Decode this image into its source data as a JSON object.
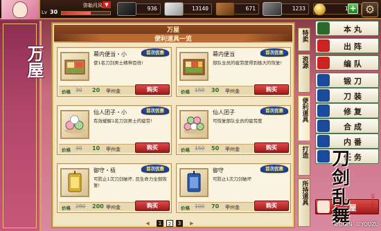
{
  "topbar": {
    "username": "弥勒月风",
    "flag": "▼",
    "lv_label": "Lv",
    "lv_value": "30",
    "lv_progress": 0.6,
    "resources": [
      {
        "name": "charcoal",
        "value": "936"
      },
      {
        "name": "steel",
        "value": "13140"
      },
      {
        "name": "coolant",
        "value": "671"
      },
      {
        "name": "whetstone",
        "value": "1233"
      }
    ],
    "coin_value": "1690",
    "plus_label": "+",
    "gear_label": "⚙"
  },
  "left_banner": {
    "title": "万屋"
  },
  "panel": {
    "title": "万屋",
    "subtitle": "便利道具一览",
    "price_label": "价格",
    "currency": "甲州金",
    "buy_label": "购买",
    "badge_label": "首次优惠",
    "items": [
      {
        "name": "幕内便当・小",
        "desc": "使1名刀剑男士精神百倍!",
        "old_price": "30",
        "new_price": "20"
      },
      {
        "name": "幕内便当",
        "desc": "部队全员的疲劳度得到极大的恢复!",
        "old_price": "150",
        "new_price": "30"
      },
      {
        "name": "仙人团子・小",
        "desc": "有效缓解1名刀剑男士的疲劳!",
        "old_price": "30",
        "new_price": "10"
      },
      {
        "name": "仙人团子",
        "desc": "可恢复部队全员的疲劳度",
        "old_price": "150",
        "new_price": "50"
      },
      {
        "name": "御守・极",
        "desc": "可防止1次刀剑破坏, 且生命力全部恢复!",
        "old_price": "280",
        "new_price": "200"
      },
      {
        "name": "御守",
        "desc": "可防止1次刀剑破坏",
        "old_price": "100",
        "new_price": "70"
      }
    ],
    "pager": {
      "prev": "◀",
      "pages": [
        "1",
        "2",
        "3"
      ],
      "current": "2",
      "next": "▶"
    }
  },
  "vtabs": [
    "特卖",
    "资源",
    "便利道具",
    "打造",
    "所持道具"
  ],
  "right_menu": [
    {
      "label": "本丸",
      "icon": "castle-icon",
      "color": "#2a6a2a"
    },
    {
      "label": "出阵",
      "icon": "flag-icon",
      "color": "#c22"
    },
    {
      "label": "编队",
      "icon": "formation-icon",
      "color": "#c22"
    },
    {
      "label": "锻刀",
      "icon": "forge-icon",
      "color": "#1a4a9a"
    },
    {
      "label": "刀装",
      "icon": "equip-icon",
      "color": "#1a4a9a"
    },
    {
      "label": "修复",
      "icon": "repair-icon",
      "color": "#1a4a9a"
    },
    {
      "label": "合成",
      "icon": "merge-icon",
      "color": "#1a4a9a"
    },
    {
      "label": "内番",
      "icon": "chore-icon",
      "color": "#1a4a9a"
    },
    {
      "label": "任务",
      "icon": "quest-icon",
      "color": "#1a4a9a"
    },
    {
      "label": "屋",
      "icon": "shop-icon",
      "color": "#c22"
    }
  ],
  "logo": {
    "text": "刀剑乱舞",
    "sub": "ONLINE"
  },
  "copyright": "©DG/N· ©YOUZU"
}
